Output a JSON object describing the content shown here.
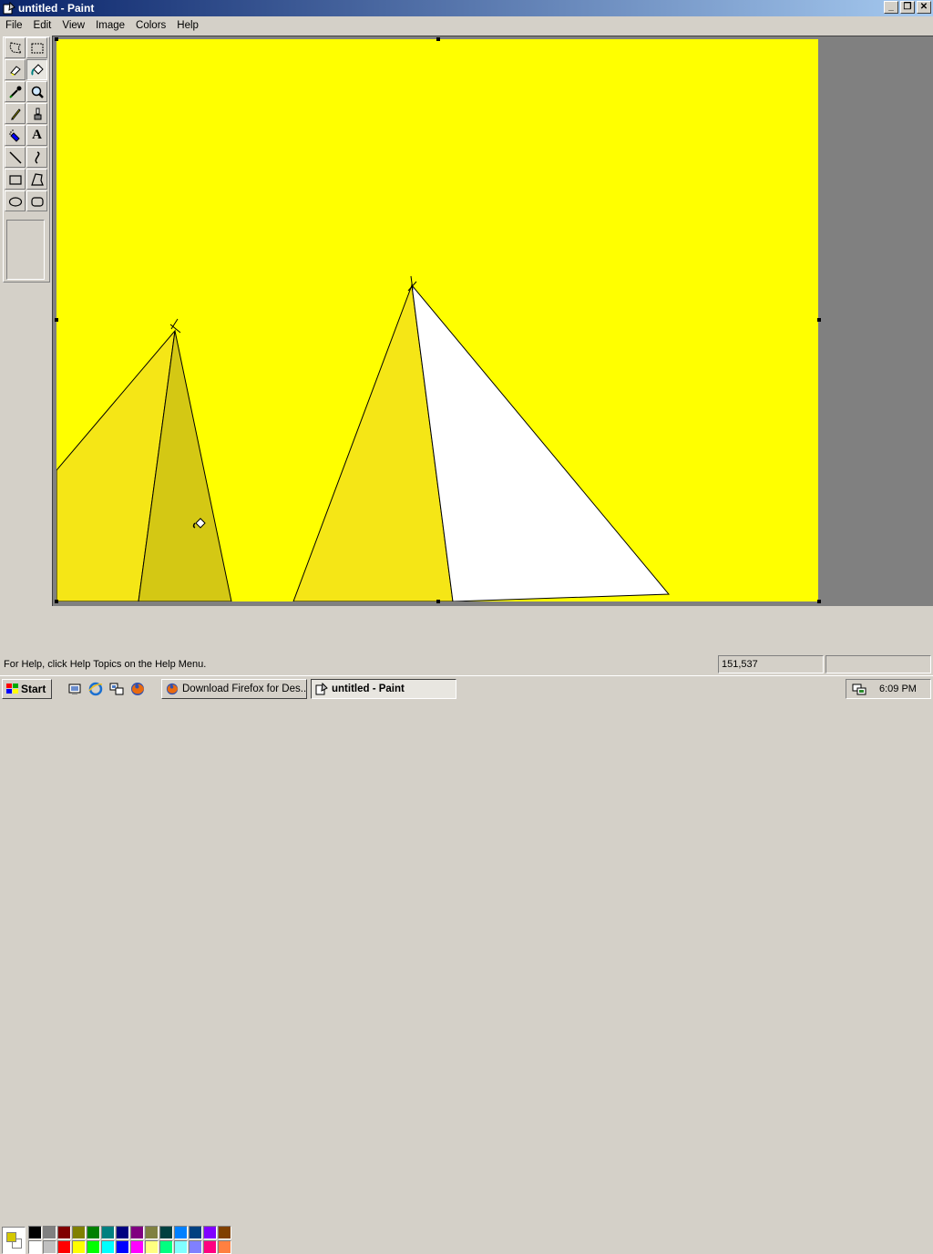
{
  "window": {
    "title": "untitled - Paint",
    "buttons": [
      "_",
      "❐",
      "✕"
    ]
  },
  "menu": [
    "File",
    "Edit",
    "View",
    "Image",
    "Colors",
    "Help"
  ],
  "tools": [
    {
      "name": "free-form-select-tool",
      "icon": "free-select-icon"
    },
    {
      "name": "select-tool",
      "icon": "rect-select-icon"
    },
    {
      "name": "eraser-tool",
      "icon": "eraser-icon"
    },
    {
      "name": "fill-tool",
      "icon": "paint-bucket-icon",
      "selected": true
    },
    {
      "name": "pick-color-tool",
      "icon": "eyedropper-icon"
    },
    {
      "name": "magnifier-tool",
      "icon": "magnifier-icon"
    },
    {
      "name": "pencil-tool",
      "icon": "pencil-icon"
    },
    {
      "name": "brush-tool",
      "icon": "brush-icon"
    },
    {
      "name": "airbrush-tool",
      "icon": "airbrush-icon"
    },
    {
      "name": "text-tool",
      "icon": "text-icon",
      "label": "A"
    },
    {
      "name": "line-tool",
      "icon": "line-icon"
    },
    {
      "name": "curve-tool",
      "icon": "curve-icon"
    },
    {
      "name": "rectangle-tool",
      "icon": "rectangle-icon"
    },
    {
      "name": "polygon-tool",
      "icon": "polygon-icon"
    },
    {
      "name": "ellipse-tool",
      "icon": "ellipse-icon"
    },
    {
      "name": "rounded-rectangle-tool",
      "icon": "rounded-rect-icon"
    }
  ],
  "colors": {
    "foreground": "#d4c800",
    "background": "#ffffff",
    "canvas": "#ffff00",
    "shape_light": "#f5e616",
    "shape_dark": "#d4c814",
    "shape_white": "#ffffff",
    "palette_top": [
      "#000000",
      "#808080",
      "#800000",
      "#808000",
      "#008000",
      "#008080",
      "#000080",
      "#800080",
      "#808040",
      "#004040",
      "#0080ff",
      "#004080",
      "#8000ff",
      "#804000"
    ],
    "palette_bottom": [
      "#ffffff",
      "#c0c0c0",
      "#ff0000",
      "#ffff00",
      "#00ff00",
      "#00ffff",
      "#0000ff",
      "#ff00ff",
      "#ffff80",
      "#00ff80",
      "#80ffff",
      "#8080ff",
      "#ff0080",
      "#ff8040"
    ]
  },
  "status": {
    "help": "For Help, click Help Topics on the Help Menu.",
    "coords": "151,537",
    "size": ""
  },
  "taskbar": {
    "start": "Start",
    "quick_launch": [
      "show-desktop-icon",
      "ie-icon",
      "network-icon",
      "firefox-icon"
    ],
    "tasks": [
      {
        "label": "Download Firefox for Des...",
        "icon": "firefox-icon",
        "active": false
      },
      {
        "label": "untitled - Paint",
        "icon": "paint-icon",
        "active": true
      }
    ],
    "clock": "6:09 PM"
  }
}
